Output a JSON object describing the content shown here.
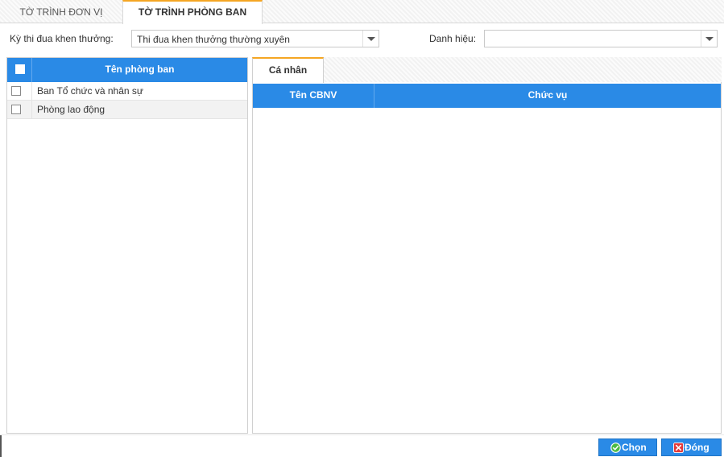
{
  "tabs": [
    {
      "label": "TỜ TRÌNH ĐƠN VỊ",
      "active": false
    },
    {
      "label": "TỜ TRÌNH PHÒNG BAN",
      "active": true
    }
  ],
  "filters": {
    "ky_thi_dua_label": "Kỳ thi đua khen thưởng:",
    "ky_thi_dua_value": "Thi đua khen thưởng thường xuyên",
    "danh_hieu_label": "Danh hiệu:",
    "danh_hieu_value": ""
  },
  "left_grid": {
    "header": "Tên phòng ban",
    "rows": [
      {
        "name": "Ban Tổ chức và nhân sự"
      },
      {
        "name": "Phòng lao động"
      }
    ]
  },
  "right_panel": {
    "tab_label": "Cá nhân",
    "columns": [
      "Tên CBNV",
      "Chức vụ"
    ]
  },
  "buttons": {
    "chon": "Chọn",
    "dong": "Đóng"
  },
  "colors": {
    "accent": "#2a8ae6",
    "tab_highlight": "#f5a623"
  }
}
